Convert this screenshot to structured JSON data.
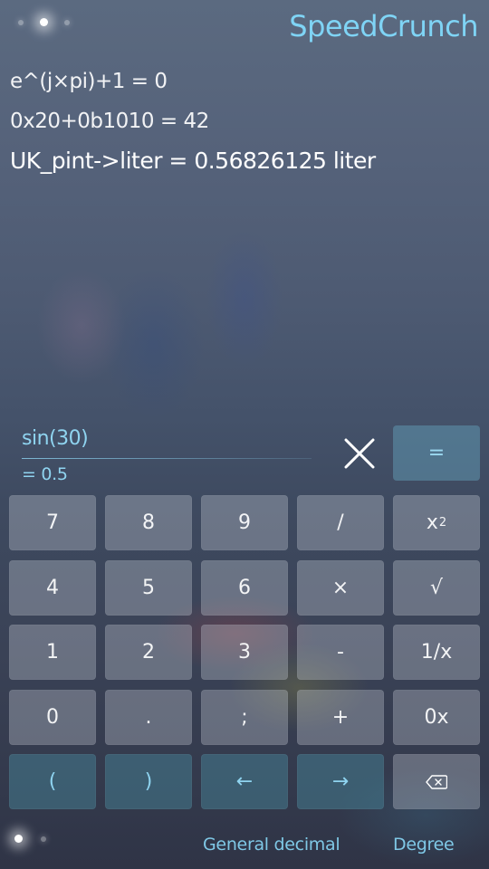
{
  "app": {
    "title": "SpeedCrunch"
  },
  "history": [
    {
      "text": "e^(j×pi)+1 = 0"
    },
    {
      "text": "0x20+0b1010 = 42"
    },
    {
      "text": "UK_pint->liter = 0.56826125 liter"
    }
  ],
  "editor": {
    "expression": "sin(30)",
    "result_preview": "= 0.5",
    "equals_label": "="
  },
  "keypad": {
    "keys": [
      {
        "label": "7"
      },
      {
        "label": "8"
      },
      {
        "label": "9"
      },
      {
        "label": "/"
      },
      {
        "label": "x",
        "sup": "2"
      },
      {
        "label": "4"
      },
      {
        "label": "5"
      },
      {
        "label": "6"
      },
      {
        "label": "×"
      },
      {
        "label": "√"
      },
      {
        "label": "1"
      },
      {
        "label": "2"
      },
      {
        "label": "3"
      },
      {
        "label": "-"
      },
      {
        "label": "1/x"
      },
      {
        "label": "0"
      },
      {
        "label": "."
      },
      {
        "label": ";"
      },
      {
        "label": "+"
      },
      {
        "label": "0x"
      },
      {
        "label": "("
      },
      {
        "label": ")"
      },
      {
        "label": "←"
      },
      {
        "label": "→"
      },
      {
        "label": ""
      }
    ]
  },
  "status": {
    "format": "General decimal",
    "angle": "Degree"
  },
  "colors": {
    "accent": "#7fd4f5",
    "key_bg": "#8a8f9c",
    "nav_key_bg": "#3f7c8e",
    "equals_bg": "#5f96af"
  },
  "icons": {
    "clear": "close-icon",
    "backspace": "backspace-icon",
    "page_indicator": "page-dot-icon"
  }
}
